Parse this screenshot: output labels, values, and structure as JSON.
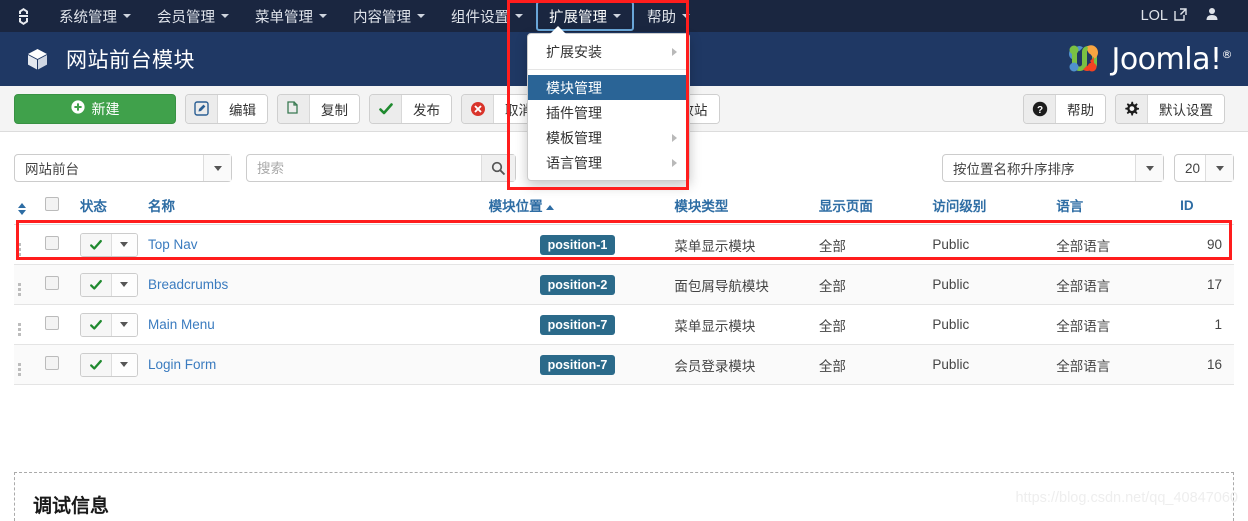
{
  "topbar": {
    "logo_icon": "joomla-mark-icon",
    "menu": [
      {
        "label": "系统管理",
        "has_caret": true,
        "active": false
      },
      {
        "label": "会员管理",
        "has_caret": true,
        "active": false
      },
      {
        "label": "菜单管理",
        "has_caret": true,
        "active": false
      },
      {
        "label": "内容管理",
        "has_caret": true,
        "active": false
      },
      {
        "label": "组件设置",
        "has_caret": true,
        "active": false
      },
      {
        "label": "扩展管理",
        "has_caret": true,
        "active": true
      },
      {
        "label": "帮助",
        "has_caret": true,
        "active": false
      }
    ],
    "site_label": "LOL",
    "site_icon": "external-link-icon",
    "user_icon": "user-icon",
    "user_caret_icon": "chevron-down-icon"
  },
  "dropdown": {
    "items": [
      {
        "label": "扩展安装",
        "submenu": true,
        "selected": false
      },
      {
        "separator": true
      },
      {
        "label": "模块管理",
        "submenu": false,
        "selected": true
      },
      {
        "label": "插件管理",
        "submenu": false,
        "selected": false
      },
      {
        "label": "模板管理",
        "submenu": true,
        "selected": false
      },
      {
        "label": "语言管理",
        "submenu": true,
        "selected": false
      }
    ]
  },
  "pagehead": {
    "icon": "cube-icon",
    "title": "网站前台模块",
    "logo_text": "Joomla!",
    "logo_sup": "®"
  },
  "toolbar": {
    "new_label": "新建",
    "new_icon": "plus-circle-icon",
    "buttons": [
      {
        "label": "编辑",
        "icon": "pencil-square-icon"
      },
      {
        "label": "复制",
        "icon": "copy-icon"
      },
      {
        "label": "发布",
        "icon": "check-icon"
      },
      {
        "label": "取消发布",
        "icon": "cancel-circle-icon"
      },
      {
        "label": "放入回收站",
        "icon": "trash-icon"
      }
    ],
    "right_buttons": [
      {
        "label": "帮助",
        "icon": "question-circle-icon"
      },
      {
        "label": "默认设置",
        "icon": "gear-icon"
      }
    ]
  },
  "filterbar": {
    "client_filter": "网站前台",
    "search_placeholder": "搜索",
    "search_value": "",
    "search_icon": "search-icon",
    "sort_value": "按位置名称升序排序",
    "limit_value": "20"
  },
  "table": {
    "headers": {
      "ordering": "",
      "checkall": "",
      "state": "状态",
      "name": "名称",
      "position": "模块位置",
      "type": "模块类型",
      "pages": "显示页面",
      "access": "访问级别",
      "language": "语言",
      "id": "ID"
    },
    "sorted_column": "模块位置",
    "sort_direction": "asc",
    "rows": [
      {
        "name": "Top Nav",
        "position": "position-1",
        "type": "菜单显示模块",
        "pages": "全部",
        "access": "Public",
        "language": "全部语言",
        "id": "90",
        "published": true,
        "highlighted": true
      },
      {
        "name": "Breadcrumbs",
        "position": "position-2",
        "type": "面包屑导航模块",
        "pages": "全部",
        "access": "Public",
        "language": "全部语言",
        "id": "17",
        "published": true,
        "highlighted": false
      },
      {
        "name": "Main Menu",
        "position": "position-7",
        "type": "菜单显示模块",
        "pages": "全部",
        "access": "Public",
        "language": "全部语言",
        "id": "1",
        "published": true,
        "highlighted": false
      },
      {
        "name": "Login Form",
        "position": "position-7",
        "type": "会员登录模块",
        "pages": "全部",
        "access": "Public",
        "language": "全部语言",
        "id": "16",
        "published": true,
        "highlighted": false
      }
    ]
  },
  "footer": {
    "debug_title": "调试信息"
  },
  "watermark": "https://blog.csdn.net/qq_40847060",
  "colors": {
    "topbar_bg": "#1a2640",
    "pagehead_bg": "#1f3864",
    "accent_link": "#3a7bbf",
    "header_link": "#2e6da4",
    "new_button": "#40a14b",
    "badge": "#2b6a8a",
    "annotation": "#ff1d1d",
    "menu_selected": "#2a6496"
  }
}
